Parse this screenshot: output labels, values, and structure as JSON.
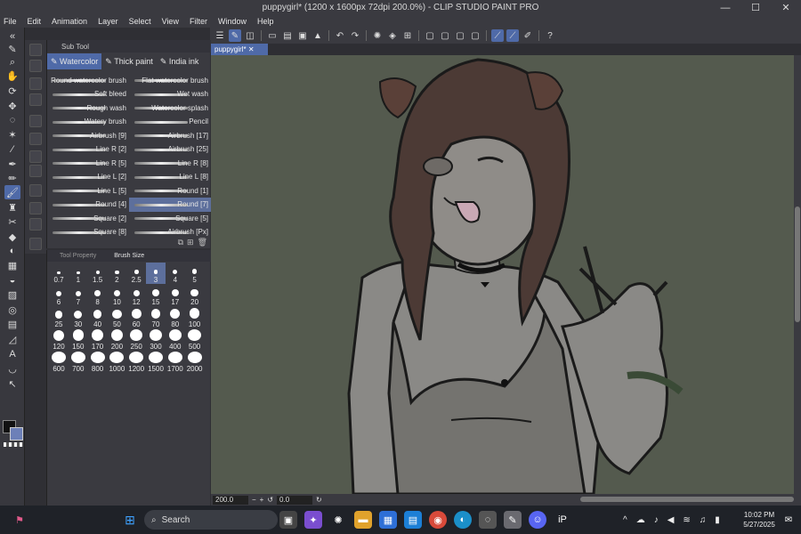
{
  "window": {
    "title": "puppygirl* (1200 x 1600px 72dpi 200.0%) - CLIP STUDIO PAINT PRO",
    "minimize": "—",
    "maximize": "☐",
    "close": "✕"
  },
  "menu": [
    "File",
    "Edit",
    "Animation",
    "Layer",
    "Select",
    "View",
    "Filter",
    "Window",
    "Help"
  ],
  "subtool": {
    "panel_title": "Sub Tool",
    "groups": [
      "Watercolor",
      "Thick paint",
      "India ink"
    ],
    "active_group": "Watercolor",
    "brushes": [
      {
        "label": "Round watercolor brush"
      },
      {
        "label": "Flat watercolor brush"
      },
      {
        "label": "Soft bleed"
      },
      {
        "label": "Wet wash"
      },
      {
        "label": "Rough wash"
      },
      {
        "label": "Watercolor splash"
      },
      {
        "label": "Watery brush"
      },
      {
        "label": "Pencil"
      },
      {
        "label": "Airbrush [9]"
      },
      {
        "label": "Airbrush [17]"
      },
      {
        "label": "Line R [2]"
      },
      {
        "label": "Airbrush [25]"
      },
      {
        "label": "Line R [5]"
      },
      {
        "label": "Line R [8]"
      },
      {
        "label": "Line L [2]"
      },
      {
        "label": "Line L [8]"
      },
      {
        "label": "Line L [5]"
      },
      {
        "label": "Round [1]"
      },
      {
        "label": "Round [4]"
      },
      {
        "label": "Round [7]"
      },
      {
        "label": "Square [2]"
      },
      {
        "label": "Square [5]"
      },
      {
        "label": "Square [8]"
      },
      {
        "label": "Airbrush [Px]"
      }
    ],
    "selected_brush": "Round [7]"
  },
  "size_panel": {
    "tabs": [
      "Tool Property",
      "Brush Size"
    ],
    "active_tab": "Brush Size",
    "sizes": [
      "0.7",
      "1",
      "1.5",
      "2",
      "2.5",
      "3",
      "4",
      "5",
      "6",
      "7",
      "8",
      "10",
      "12",
      "15",
      "17",
      "20",
      "25",
      "30",
      "40",
      "50",
      "60",
      "70",
      "80",
      "100",
      "120",
      "150",
      "170",
      "200",
      "250",
      "300",
      "400",
      "500",
      "600",
      "700",
      "800",
      "1000",
      "1200",
      "1500",
      "1700",
      "2000"
    ],
    "selected_size": "3"
  },
  "canvas": {
    "tab_label": "puppygirl*",
    "zoom": "200.0",
    "rotation": "0.0",
    "background_color": "#545a4e"
  },
  "taskbar": {
    "search_placeholder": "Search",
    "time": "10:02 PM",
    "date": "5/27/2025"
  },
  "colors": {
    "accent": "#4f6aa8",
    "main_color": "#111111",
    "sub_color": "#6d80b8"
  }
}
